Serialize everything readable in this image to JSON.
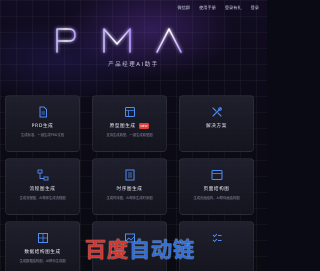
{
  "nav": {
    "items": [
      "微信群",
      "使用手册",
      "登录有礼",
      "登录"
    ]
  },
  "brand": {
    "logo": "PMAI",
    "subtitle": "产品经理AI助手",
    "accent": "#8a5cff"
  },
  "cards": [
    {
      "title": "PRD生成",
      "badge": "",
      "desc": "生成标准、一键生成PRD文档",
      "icon": "document-icon"
    },
    {
      "title": "原型图生成",
      "badge": "NEW",
      "desc": "支持生成原型、一键生成原型图",
      "icon": "prototype-icon"
    },
    {
      "title": "解决方案",
      "badge": "",
      "desc": "",
      "icon": "tools-icon"
    },
    {
      "title": "流程图生成",
      "badge": "",
      "desc": "生成流程图，AI帮你生成流程图",
      "icon": "flowchart-icon"
    },
    {
      "title": "时序图生成",
      "badge": "",
      "desc": "生成时序图，AI帮你生成时序图",
      "icon": "sequence-icon"
    },
    {
      "title": "页面结构图",
      "badge": "",
      "desc": "生成页面结构，AI帮你画结构图",
      "icon": "structure-icon"
    },
    {
      "title": "数据结构图生成",
      "badge": "",
      "desc": "生成数据结构图，AI帮你生成图",
      "icon": "data-structure-icon"
    },
    {
      "title": "",
      "badge": "",
      "desc": "",
      "icon": "image-icon"
    },
    {
      "title": "",
      "badge": "",
      "desc": "",
      "icon": "checklist-icon"
    }
  ],
  "watermark": {
    "text_red": "百度",
    "text_blue": "自动链"
  }
}
